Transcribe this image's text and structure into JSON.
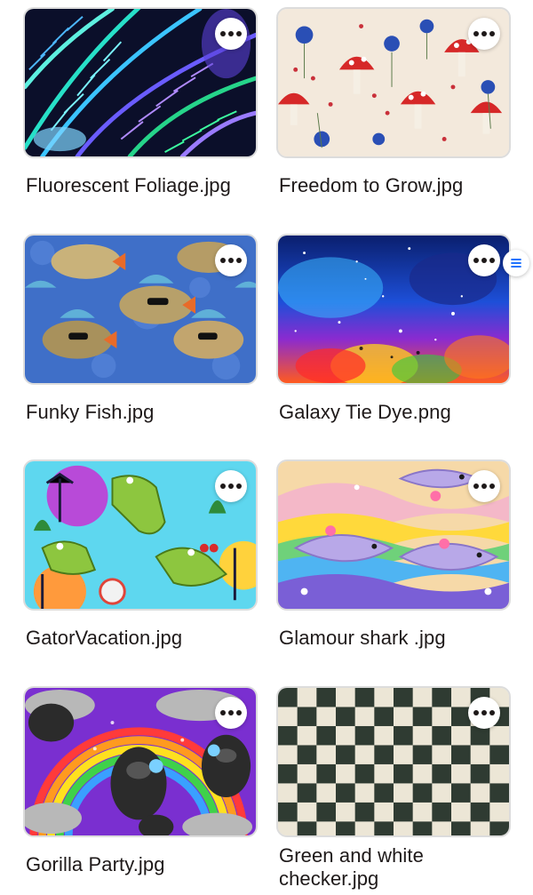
{
  "files": [
    {
      "name": "Fluorescent Foliage.jpg",
      "more_icon": "more-horizontal-icon"
    },
    {
      "name": "Freedom to Grow.jpg",
      "more_icon": "more-horizontal-icon"
    },
    {
      "name": "Funky Fish.jpg",
      "more_icon": "more-horizontal-icon"
    },
    {
      "name": "Galaxy Tie Dye.png",
      "more_icon": "more-horizontal-icon"
    },
    {
      "name": "GatorVacation.jpg",
      "more_icon": "more-horizontal-icon"
    },
    {
      "name": "Glamour shark .jpg",
      "more_icon": "more-horizontal-icon"
    },
    {
      "name": "Gorilla Party.jpg",
      "more_icon": "more-horizontal-icon"
    },
    {
      "name": "Green and white checker.jpg",
      "more_icon": "more-horizontal-icon"
    }
  ],
  "side_handle": {
    "icon": "list-icon",
    "color": "#0061fe"
  }
}
